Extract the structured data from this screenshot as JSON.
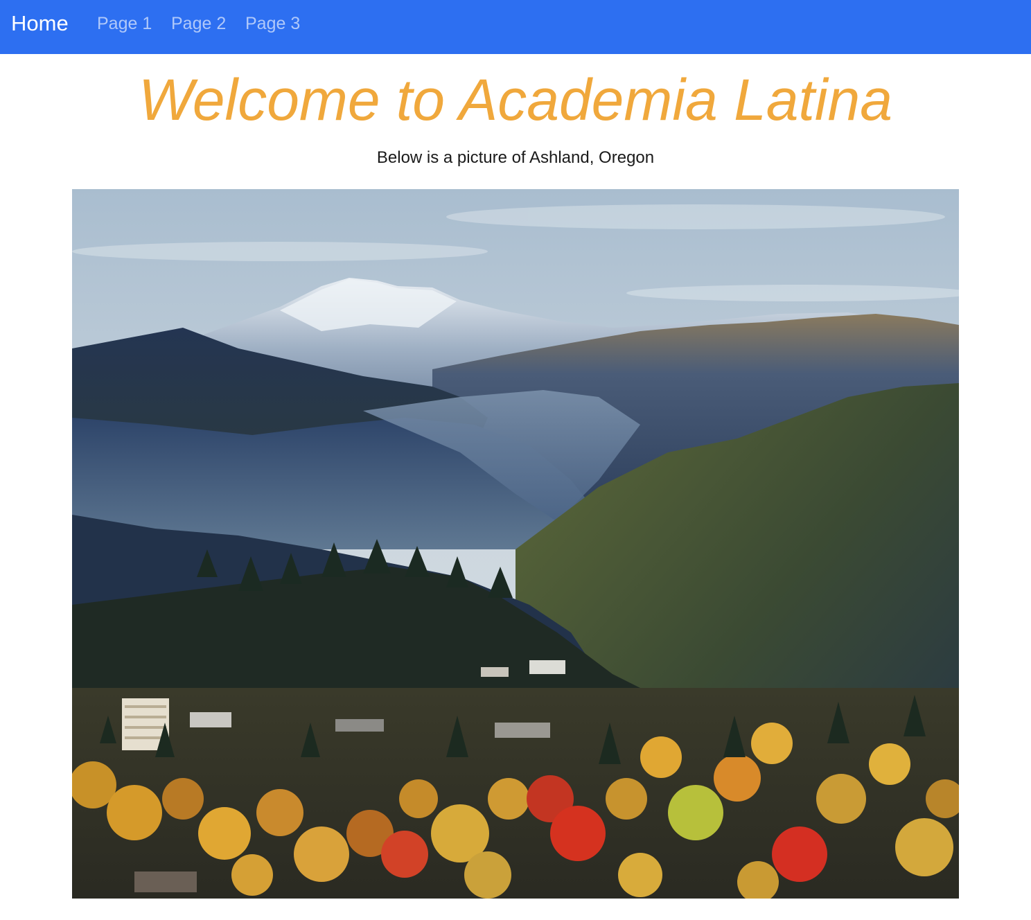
{
  "navbar": {
    "brand": "Home",
    "links": [
      {
        "label": "Page 1"
      },
      {
        "label": "Page 2"
      },
      {
        "label": "Page 3"
      }
    ],
    "color": "#2d6ff1"
  },
  "main": {
    "title": "Welcome to Academia Latina",
    "title_color": "#f0a83c",
    "subtitle": "Below is a picture of Ashland, Oregon"
  }
}
